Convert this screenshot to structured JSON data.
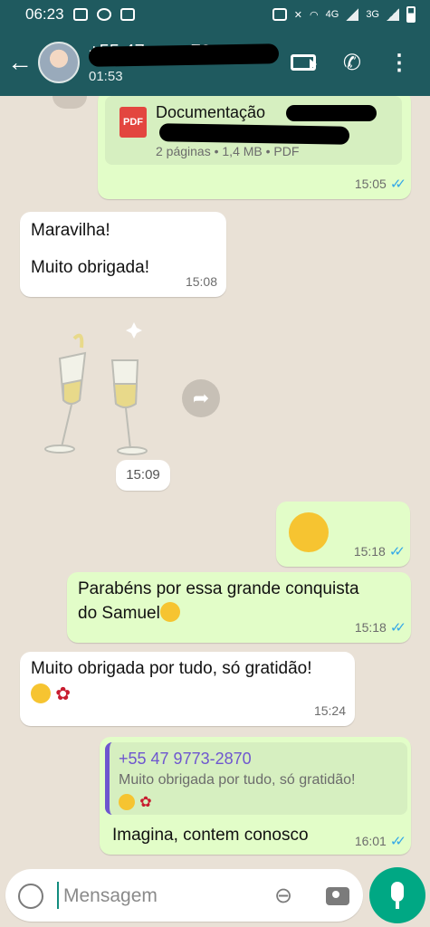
{
  "status_bar": {
    "time": "06:23",
    "net1": "4G",
    "net2": "3G"
  },
  "header": {
    "contact_name": "+55 47 ···· ··70",
    "subtitle": "01:53"
  },
  "messages": [
    {
      "id": "pdf",
      "doc_title": "Documentação",
      "doc_meta": "2 páginas • 1,4 MB • PDF",
      "badge": "PDF",
      "time": "15:05"
    },
    {
      "id": "m1",
      "line1": "Maravilha!",
      "line2": "Muito obrigada!",
      "time": "15:08"
    },
    {
      "id": "sticker",
      "time": "15:09"
    },
    {
      "id": "emoji",
      "time": "15:18"
    },
    {
      "id": "m2",
      "line1": "Parabéns por essa grande conquista",
      "line2": "do Samuel",
      "time": "15:18"
    },
    {
      "id": "m3",
      "line1": "Muito obrigada por tudo, só gratidão!",
      "time": "15:24"
    },
    {
      "id": "reply",
      "quote_name": "+55 47 9773-2870",
      "quote_text": "Muito obrigada por tudo, só gratidão!",
      "text": "Imagina, contem conosco",
      "time": "16:01"
    }
  ],
  "composer": {
    "placeholder": "Mensagem"
  },
  "colors": {
    "header": "#1f5a5f",
    "outgoing": "#e2fdc8",
    "incoming": "#ffffff",
    "read_ticks": "#34a8e8",
    "mic": "#00a884"
  }
}
